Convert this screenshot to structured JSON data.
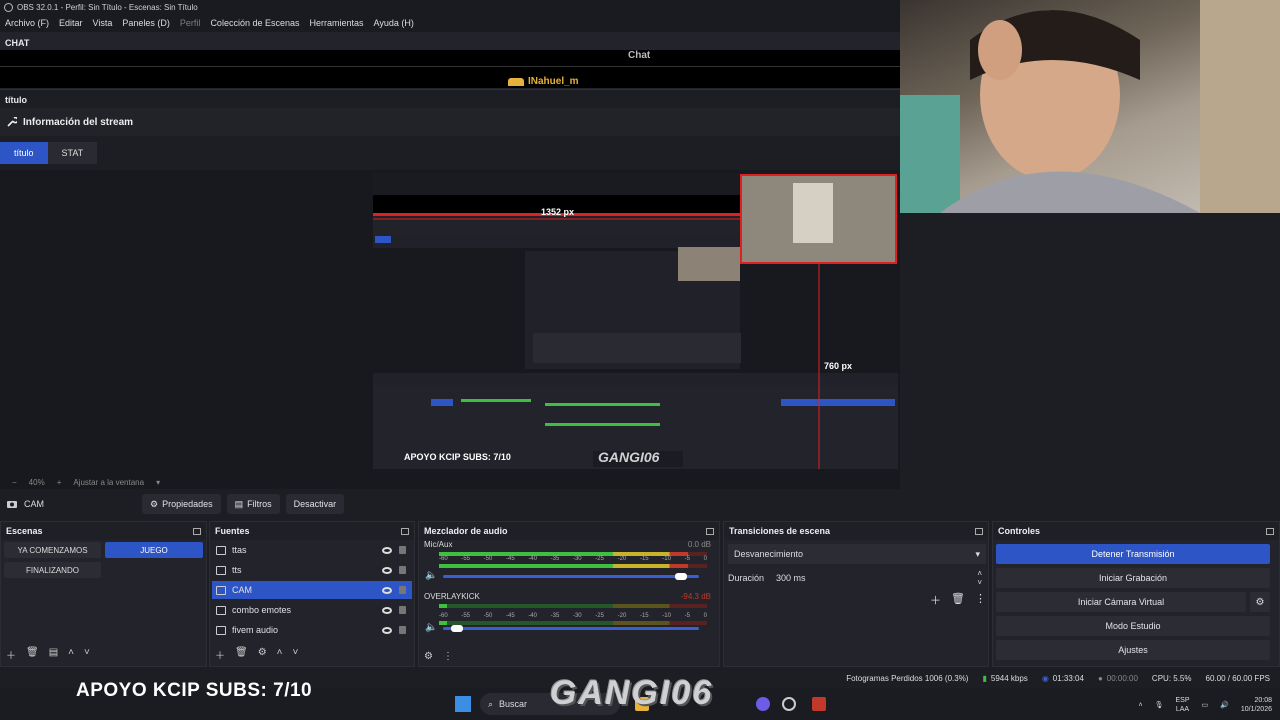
{
  "window": {
    "title": "OBS 32.0.1 - Perfil: Sin Título - Escenas: Sin Título"
  },
  "menu": {
    "items": [
      "Archivo (F)",
      "Editar",
      "Vista",
      "Paneles (D)",
      "Perfil",
      "Colección de Escenas",
      "Herramientas",
      "Ayuda (H)"
    ]
  },
  "chat_dock": {
    "title": "CHAT",
    "heading": "Chat",
    "username": "INahuel_m"
  },
  "titulo_dock": {
    "title": "título",
    "stream_info": "Información del stream",
    "tabs": [
      "título",
      "STAT"
    ]
  },
  "preview_nested": {
    "width_label": "1352 px",
    "height_label": "760 px",
    "subs": "APOYO KCIP SUBS: 7/10",
    "logo": "GANGI06"
  },
  "zoom": {
    "value": "40%",
    "minus": "−",
    "plus": "+",
    "fit": "Ajustar a la ventana"
  },
  "source_toolbar": {
    "source_name": "CAM",
    "properties": "Propiedades",
    "filters": "Filtros",
    "deactivate": "Desactivar"
  },
  "scenes": {
    "title": "Escenas",
    "items": [
      {
        "label": "YA COMENZAMOS",
        "active": false
      },
      {
        "label": "JUEGO",
        "active": true
      },
      {
        "label": "FINALIZANDO",
        "active": false
      }
    ]
  },
  "sources": {
    "title": "Fuentes",
    "items": [
      {
        "label": "ttas",
        "selected": false
      },
      {
        "label": "tts",
        "selected": false
      },
      {
        "label": "CAM",
        "selected": true
      },
      {
        "label": "combo emotes",
        "selected": false
      },
      {
        "label": "fivem audio",
        "selected": false
      }
    ]
  },
  "mixer": {
    "title": "Mezclador de audio",
    "channels": [
      {
        "name": "Mic/Aux",
        "db": "0.0 dB",
        "level": 0.93
      },
      {
        "name": "OVERLAYKICK",
        "db": "-94.3 dB",
        "level": 0.03
      }
    ],
    "ticks": [
      "-60",
      "-55",
      "-50",
      "-45",
      "-40",
      "-35",
      "-30",
      "-25",
      "-20",
      "-15",
      "-10",
      "-5",
      "0"
    ]
  },
  "transitions": {
    "title": "Transiciones de escena",
    "selected": "Desvanecimiento",
    "duration_label": "Duración",
    "duration_value": "300 ms"
  },
  "controls": {
    "title": "Controles",
    "buttons": [
      "Detener Transmisión",
      "Iniciar Grabación",
      "Iniciar Cámara Virtual",
      "Modo Estudio",
      "Ajustes"
    ]
  },
  "status": {
    "dropped": "Fotogramas Perdidos 1006 (0.3%)",
    "bitrate": "5944 kbps",
    "live_time": "01:33:04",
    "rec_time": "00:00:00",
    "cpu": "CPU: 5.5%",
    "fps": "60.00 / 60.00 FPS"
  },
  "overlay": {
    "subs": "APOYO KCIP SUBS: 7/10",
    "logo": "GANGI06"
  },
  "taskbar": {
    "search": "Buscar",
    "lang1": "ESP",
    "lang2": "LAA",
    "time": "20:08",
    "date": "10/1/2026"
  },
  "colors": {
    "accent": "#2e55c6",
    "meter_green": "#3fbf3f",
    "meter_yellow": "#c9b32a",
    "meter_red": "#c0392b",
    "selection_red": "#e02020"
  }
}
